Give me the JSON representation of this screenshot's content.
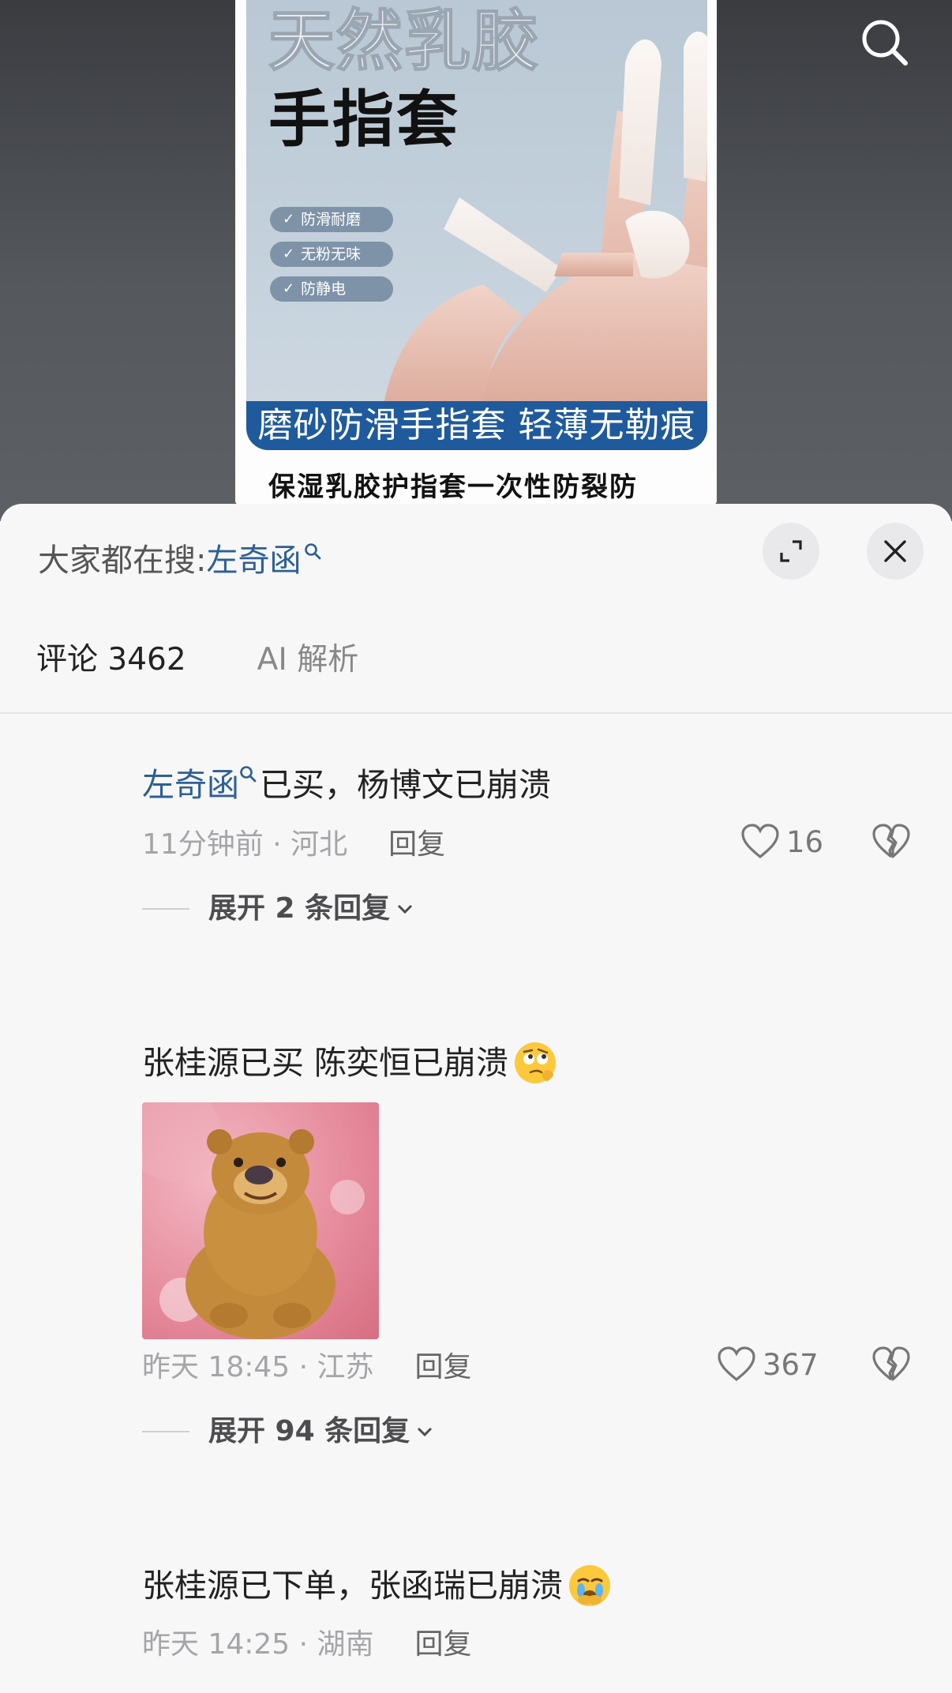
{
  "video": {
    "product": {
      "title_line1": "天然乳胶",
      "title_line2": "手指套",
      "badges": [
        "防滑耐磨",
        "无粉无味",
        "防静电"
      ],
      "banner": "磨砂防滑手指套 轻薄无勒痕",
      "subtitle": "保湿乳胶护指套一次性防裂防"
    }
  },
  "sheet": {
    "hot_search_prefix": "大家都在搜:",
    "hot_search_keyword": "左奇函",
    "tabs": [
      {
        "label": "评论 3462",
        "active": true
      },
      {
        "label": "AI 解析",
        "active": false
      }
    ]
  },
  "comments": [
    {
      "keyword": "左奇函",
      "text": "已买，杨博文已崩溃",
      "time_location": "11分钟前 · 河北",
      "reply_label": "回复",
      "likes": "16",
      "expand_label": "展开 2 条回复"
    },
    {
      "text": "张桂源已买  陈奕恒已崩溃",
      "emoji": "thinking-eye-roll-emoji",
      "has_image": true,
      "time_location": "昨天 18:45 · 江苏",
      "reply_label": "回复",
      "likes": "367",
      "expand_label": "展开 94 条回复"
    },
    {
      "text": "张桂源已下单，张函瑞已崩溃",
      "emoji": "crying-emoji",
      "time_location": "昨天 14:25 · 湖南",
      "reply_label": "回复"
    }
  ],
  "colors": {
    "keyword": "#2e5f95",
    "banner": "#1f5a9c",
    "muted": "#a5a5a8"
  }
}
